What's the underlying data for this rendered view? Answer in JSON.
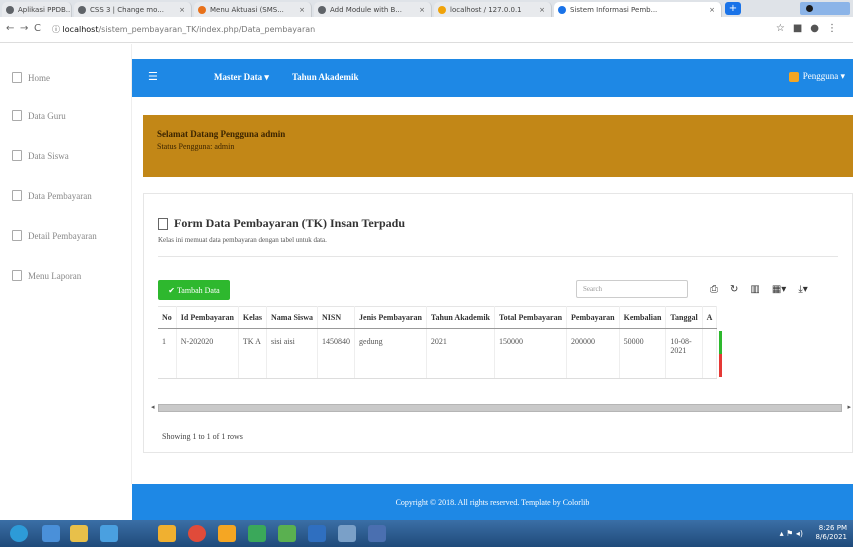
{
  "browser": {
    "tabs": [
      {
        "label": "Aplikasi PPDB..."
      },
      {
        "label": "CSS 3 | Change mo..."
      },
      {
        "label": "Menu Aktuasi (SMS..."
      },
      {
        "label": "Add Module with B..."
      },
      {
        "label": "localhost / 127.0.0.1"
      },
      {
        "label": "Sistem Informasi Pemb..."
      }
    ],
    "url_host": "localhost",
    "url_path": "/sistem_pembayaran_TK/index.php/Data_pembayaran"
  },
  "sidebar": {
    "items": [
      {
        "label": "Home"
      },
      {
        "label": "Data Guru"
      },
      {
        "label": "Data Siswa"
      },
      {
        "label": "Data Pembayaran"
      },
      {
        "label": "Detail Pembayaran"
      },
      {
        "label": "Menu Laporan"
      }
    ]
  },
  "topnav": {
    "menu_master": "Master Data ▾",
    "menu_tahun": "Tahun Akademik",
    "user": "Pengguna ▾"
  },
  "banner": {
    "line1": "Selamat Datang Pengguna admin",
    "line2": "Status Pengguna: admin"
  },
  "card": {
    "title": "Form Data Pembayaran (TK) Insan Terpadu",
    "subtitle": "Kelas ini memuat data pembayaran dengan tabel untuk data.",
    "add_button": "Tambah Data",
    "search_placeholder": "Search",
    "showing": "Showing 1 to 1 of 1 rows"
  },
  "table": {
    "headers": [
      "No",
      "Id Pembayaran",
      "Kelas",
      "Nama Siswa",
      "NISN",
      "Jenis Pembayaran",
      "Tahun Akademik",
      "Total Pembayaran",
      "Pembayaran",
      "Kembalian",
      "Tanggal",
      "A"
    ],
    "rows": [
      [
        "1",
        "N-202020",
        "TK A",
        "sisi aisi",
        "1450840",
        "gedung",
        "2021",
        "150000",
        "200000",
        "50000",
        "10-08-2021",
        ""
      ]
    ]
  },
  "footer": {
    "text": "Copyright © 2018. All rights reserved. Template by Colorlib"
  },
  "taskbar": {
    "time": "8:26 PM",
    "date": "8/6/2021"
  },
  "colors": {
    "primary": "#1e88e5",
    "banner": "#c28717",
    "success": "#2eb82e",
    "danger": "#e53935"
  }
}
